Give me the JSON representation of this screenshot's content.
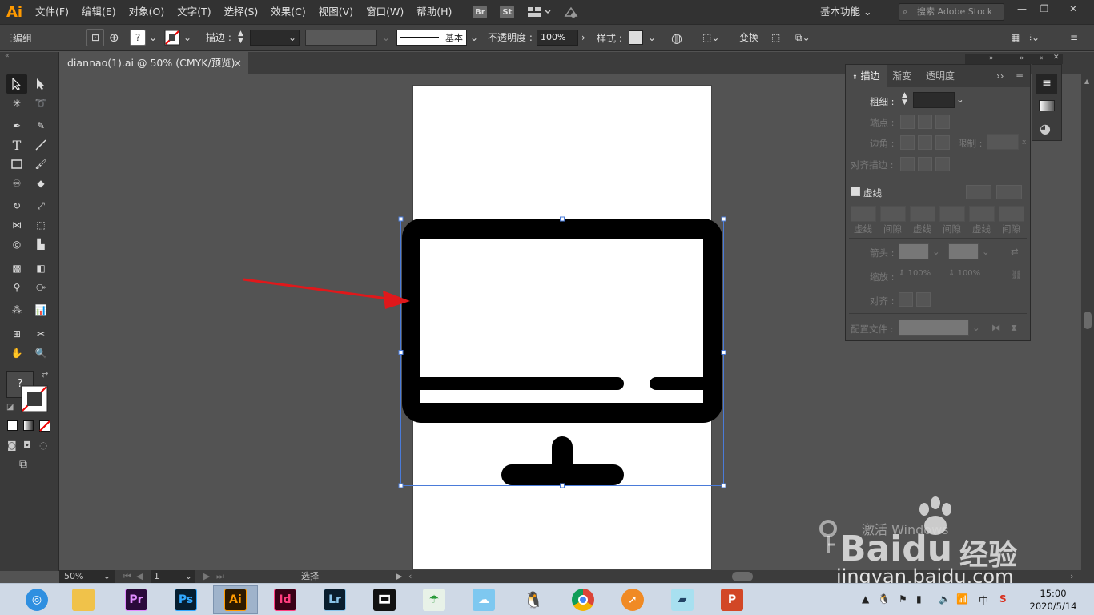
{
  "app": {
    "logo": "Ai",
    "workspace": "基本功能",
    "stock_search_placeholder": "搜索 Adobe Stock"
  },
  "menu": [
    "文件(F)",
    "编辑(E)",
    "对象(O)",
    "文字(T)",
    "选择(S)",
    "效果(C)",
    "视图(V)",
    "窗口(W)",
    "帮助(H)"
  ],
  "menubar_icons": {
    "bridge": "Br",
    "stock": "St"
  },
  "control": {
    "mode_label": "编组",
    "fill_unknown": "?",
    "stroke_label": "描边 :",
    "stroke_profile": "基本",
    "opacity_label": "不透明度 :",
    "opacity_value": "100%",
    "style_label": "样式 :",
    "transform_label": "变换"
  },
  "document": {
    "tab_title": "diannao(1).ai @ 50% (CMYK/预览)",
    "close": "×"
  },
  "toolbar": {
    "fill_unknown": "?"
  },
  "status": {
    "zoom": "50%",
    "artboard": "1",
    "tool": "选择"
  },
  "stroke_panel": {
    "tabs": [
      "描边",
      "渐变",
      "透明度"
    ],
    "weight_label": "粗细 :",
    "cap_label": "端点 :",
    "corner_label": "边角 :",
    "limit_label": "限制 :",
    "limit_unit": "x",
    "align_label": "对齐描边 :",
    "dashed_label": "虚线",
    "dash_fields": [
      "虚线",
      "间隙",
      "虚线",
      "间隙",
      "虚线",
      "间隙"
    ],
    "arrow_label": "箭头 :",
    "scale_label": "缩放 :",
    "scale_values": [
      "100%",
      "100%"
    ],
    "arrow_align_label": "对齐 :",
    "profile_label": "配置文件 :"
  },
  "taskbar": {
    "apps": [
      {
        "name": "360-browser",
        "label": ""
      },
      {
        "name": "file-explorer",
        "label": ""
      },
      {
        "name": "premiere",
        "label": "Pr"
      },
      {
        "name": "photoshop",
        "label": "Ps"
      },
      {
        "name": "illustrator",
        "label": "Ai"
      },
      {
        "name": "indesign",
        "label": "Id"
      },
      {
        "name": "lightroom",
        "label": "Lr"
      },
      {
        "name": "video-editor",
        "label": ""
      },
      {
        "name": "green-app",
        "label": ""
      },
      {
        "name": "cloud-app",
        "label": ""
      },
      {
        "name": "qq",
        "label": ""
      },
      {
        "name": "chrome",
        "label": ""
      },
      {
        "name": "orange-app",
        "label": ""
      },
      {
        "name": "notes-app",
        "label": ""
      },
      {
        "name": "powerpoint",
        "label": "P"
      }
    ],
    "ime": "中",
    "time": "15:00",
    "date": "2020/5/14"
  },
  "watermark": {
    "activate": "激活 Windows",
    "brand": "Baidu",
    "brand_cn": "经验",
    "url": "jingyan.baidu.com"
  },
  "colors": {
    "accent": "#ff9a00",
    "selection": "#4a7bd9",
    "arrow": "#e0181b"
  }
}
